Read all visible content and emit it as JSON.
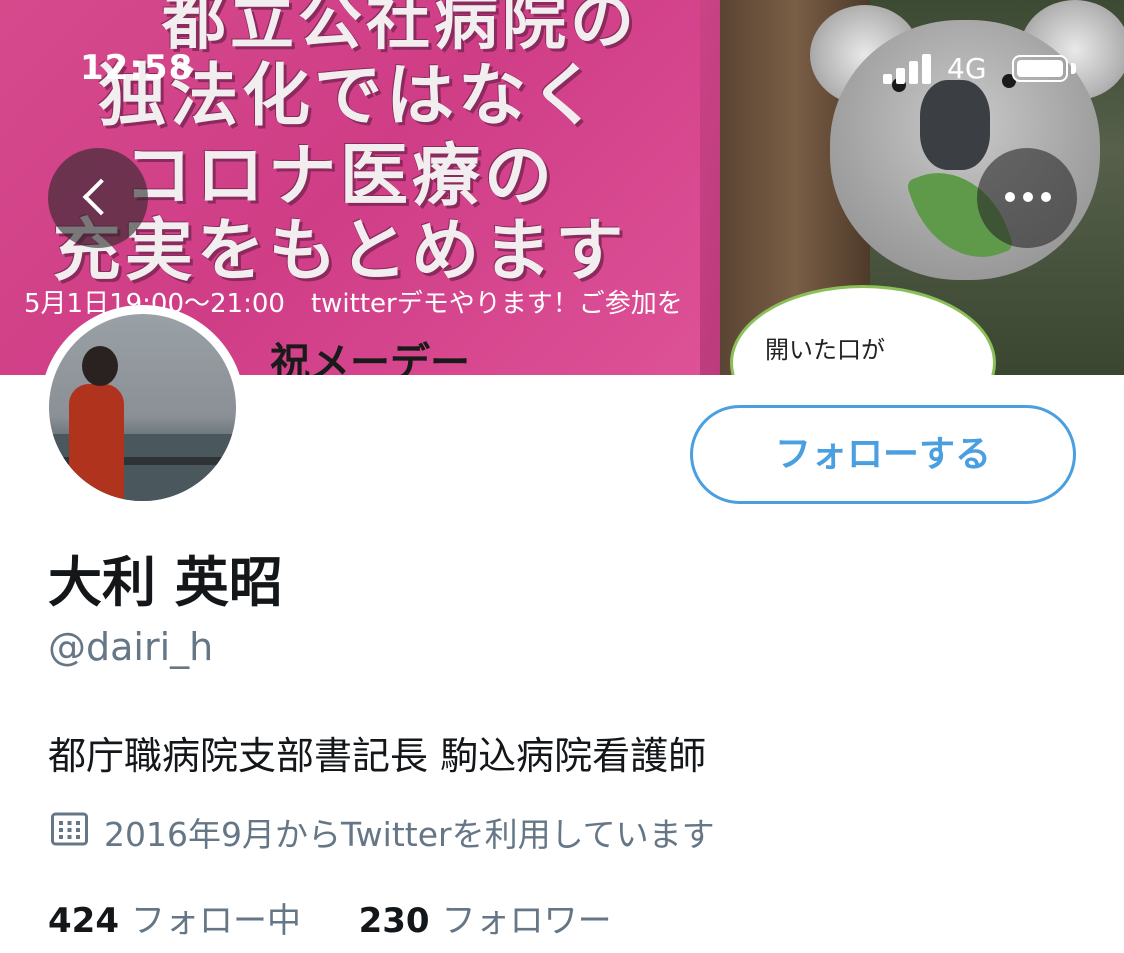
{
  "status_bar": {
    "time": "12:58",
    "network": "4G"
  },
  "banner": {
    "poster_lines": [
      "都立公社病院の",
      "独法化ではなく",
      "コロナ医療の",
      "充実をもとめます"
    ],
    "poster_subtitle": "5月1日19:00〜21:00　twitterデモやります！ご参加を",
    "poster_footer": "祝メーデー",
    "speech_bubble": "開いた口が"
  },
  "nav": {
    "back_icon": "chevron-left-icon",
    "more_icon": "more-horizontal-icon"
  },
  "profile": {
    "display_name": "大利 英昭",
    "handle": "@dairi_h",
    "bio": "都庁職病院支部書記長 駒込病院看護師",
    "joined": "2016年9月からTwitterを利用しています",
    "following_count": "424",
    "following_label": "フォロー中",
    "followers_count": "230",
    "followers_label": "フォロワー"
  },
  "actions": {
    "follow_label": "フォローする"
  },
  "colors": {
    "accent": "#4a9fe0",
    "secondary_text": "#657786",
    "primary_text": "#14171a"
  }
}
